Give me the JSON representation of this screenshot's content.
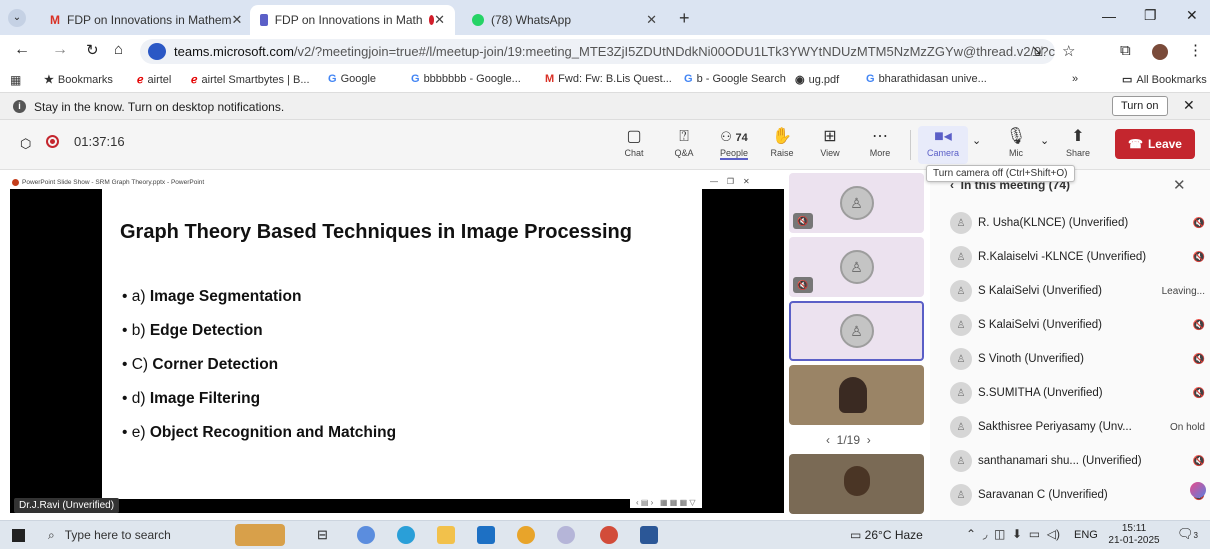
{
  "browser": {
    "tabs": [
      {
        "title": "FDP on Innovations in Mathem",
        "active": false
      },
      {
        "title": "FDP on Innovations in Math",
        "active": true
      },
      {
        "title": "(78) WhatsApp",
        "active": false
      }
    ],
    "new_tab": "+",
    "url_host": "teams.microsoft.com",
    "url_rest": "/v2/?meetingjoin=true#/l/meetup-join/19:meeting_MTE3ZjI5ZDUtNDdkNi00ODU1LTk3YWYtNDUzMTM5NzMzZGYw@thread.v2/0?c...",
    "bookmarks": [
      "Bookmarks",
      "airtel",
      "airtel Smartbytes | B...",
      "Google",
      "bbbbbbb - Google...",
      "Fwd: Fw: B.Lis Quest...",
      "b - Google Search",
      "ug.pdf",
      "bharathidasan unive..."
    ],
    "more_bookmarks": "»",
    "all_bookmarks": "All Bookmarks",
    "notification": "Stay in the know. Turn on desktop notifications.",
    "turn_on": "Turn on"
  },
  "meeting": {
    "timer": "01:37:16",
    "buttons": {
      "chat": "Chat",
      "qa": "Q&A",
      "people": "People",
      "people_count": "74",
      "raise": "Raise",
      "view": "View",
      "more": "More",
      "camera": "Camera",
      "mic": "Mic",
      "share": "Share",
      "leave": "Leave"
    },
    "tooltip": "Turn camera off (Ctrl+Shift+O)",
    "panel_title": "In this meeting (74)",
    "participants": [
      {
        "name": "R. Usha(KLNCE) (Unverified)",
        "status": ""
      },
      {
        "name": "R.Kalaiselvi -KLNCE (Unverified)",
        "status": ""
      },
      {
        "name": "S KalaiSelvi (Unverified)",
        "status": "Leaving..."
      },
      {
        "name": "S KalaiSelvi (Unverified)",
        "status": ""
      },
      {
        "name": "S Vinoth (Unverified)",
        "status": ""
      },
      {
        "name": "S.SUMITHA (Unverified)",
        "status": ""
      },
      {
        "name": "Sakthisree Periyasamy (Unv...",
        "status": "On hold"
      },
      {
        "name": "santhanamari shu... (Unverified)",
        "status": ""
      },
      {
        "name": "Saravanan C (Unverified)",
        "status": ""
      }
    ],
    "pager": "1/19",
    "presenter": "Dr.J.Ravi (Unverified)"
  },
  "slideshow": {
    "window_title": "PowerPoint Slide Show - SRM Graph Theory.pptx - PowerPoint",
    "slide_title": "Graph Theory Based Techniques in Image Processing",
    "bullets": [
      {
        "prefix": "a) ",
        "text": "Image Segmentation"
      },
      {
        "prefix": "b) ",
        "text": "Edge Detection"
      },
      {
        "prefix": "C) ",
        "text": "Corner Detection"
      },
      {
        "prefix": "d) ",
        "text": "Image Filtering"
      },
      {
        "prefix": "e) ",
        "text": "Object Recognition and Matching"
      }
    ]
  },
  "taskbar": {
    "search": "Type here to search",
    "weather": "26°C  Haze",
    "lang": "ENG",
    "time": "15:11",
    "date": "21-01-2025",
    "badge": "3"
  }
}
